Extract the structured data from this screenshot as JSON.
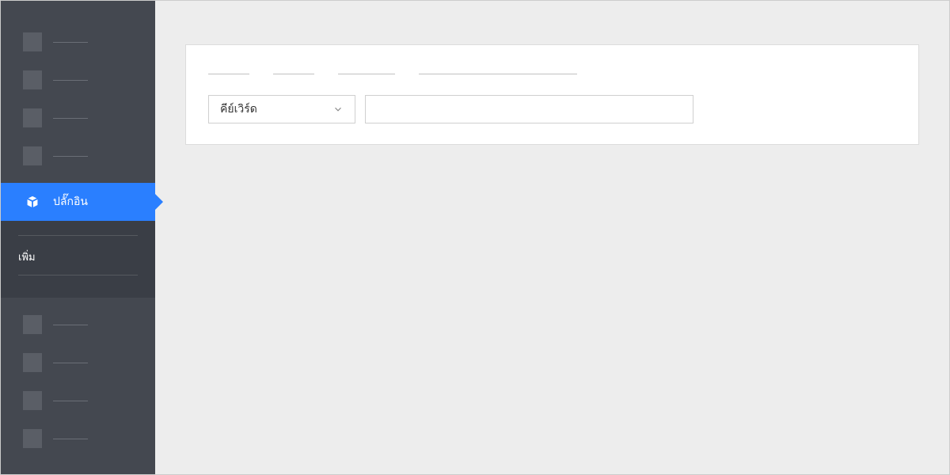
{
  "sidebar": {
    "active_item": {
      "label": "ปลั๊กอิน",
      "icon": "plugin-icon"
    },
    "submenu": {
      "item1": "เพิ่ม"
    }
  },
  "panel": {
    "filter": {
      "select_label": "คีย์เวิร์ด",
      "search_value": ""
    }
  }
}
